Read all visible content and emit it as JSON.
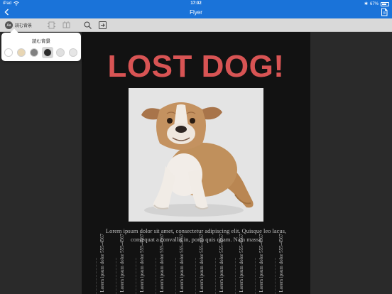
{
  "status_bar": {
    "device": "iPad",
    "time": "17:02",
    "battery": "67%"
  },
  "nav": {
    "title": "Flyer"
  },
  "toolbar": {
    "background_button_label": "読む背景",
    "background_button_badge": "Aa"
  },
  "popover": {
    "title": "読む背景",
    "swatches": [
      "#ffffff",
      "#e8d6b4",
      "#808080",
      "#2b2b2b",
      "#e0e0e0",
      "#e6e6e6"
    ],
    "selected_index": 3
  },
  "flyer": {
    "headline": "LOST DOG!",
    "body": "Lorem ipsum dolor sit amet, consectetur adipiscing elit. Quisque leo lacus, consequat a convallis in, porta quis quam. Nam massa",
    "tear_tabs": [
      "Lorem ipsum dolor 555-4567",
      "Lorem ipsum dolor 555-4567",
      "Lorem ipsum dolor 555-4567",
      "Lorem ipsum dolor 555-4567",
      "Lorem ipsum dolor 555-4567",
      "Lorem ipsum dolor 555-4567",
      "Lorem ipsum dolor 555-4567",
      "Lorem ipsum dolor 555-4567",
      "Lorem ipsum dolor 555-4567",
      "Lorem ipsum dolor 555-4567"
    ]
  },
  "colors": {
    "nav_blue": "#1a73d9",
    "headline_red": "#d85454",
    "page_bg": "#121212"
  },
  "icons": {
    "back": "chevron-left-icon",
    "document": "document-icon",
    "search": "search-icon",
    "exit": "exit-icon"
  }
}
